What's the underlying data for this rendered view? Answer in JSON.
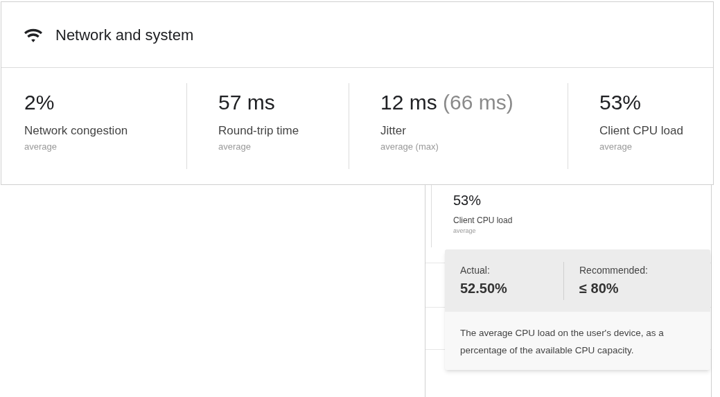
{
  "card": {
    "title": "Network and system",
    "metrics": [
      {
        "value": "2%",
        "label": "Network congestion",
        "sublabel": "average"
      },
      {
        "value": "57 ms",
        "label": "Round-trip time",
        "sublabel": "average"
      },
      {
        "value": "12 ms",
        "secondary": "(66 ms)",
        "label": "Jitter",
        "sublabel": "average (max)"
      },
      {
        "value": "53%",
        "label": "Client CPU load",
        "sublabel": "average"
      }
    ]
  },
  "detail": {
    "metric": {
      "value": "53%",
      "label": "Client CPU load",
      "sublabel": "average"
    },
    "tooltip": {
      "actual_label": "Actual:",
      "actual_value": "52.50%",
      "recommended_label": "Recommended:",
      "recommended_value": "≤ 80%",
      "description": "The average CPU load on the user's device, as a percentage of the available CPU capacity."
    }
  }
}
